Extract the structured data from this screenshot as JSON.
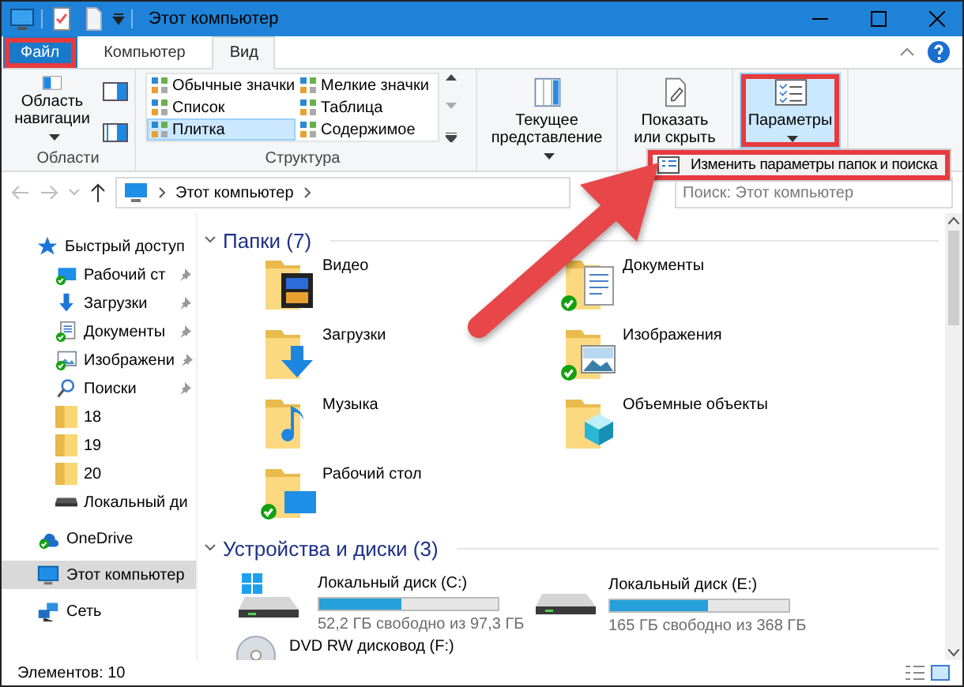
{
  "window": {
    "title": "Этот компьютер"
  },
  "ribbon": {
    "tabs": [
      {
        "label": "Файл",
        "kind": "file",
        "selected": false,
        "highlighted": true
      },
      {
        "label": "Компьютер",
        "kind": "tab",
        "selected": false,
        "highlighted": false
      },
      {
        "label": "Вид",
        "kind": "tab",
        "selected": true,
        "highlighted": false
      }
    ],
    "panes_group": {
      "label": "Области",
      "nav_button": "Область навигации"
    },
    "layout_group": {
      "label": "Структура",
      "layouts": [
        {
          "label": "Обычные значки",
          "selected": false
        },
        {
          "label": "Мелкие значки",
          "selected": false
        },
        {
          "label": "Список",
          "selected": false
        },
        {
          "label": "Таблица",
          "selected": false
        },
        {
          "label": "Плитка",
          "selected": true
        },
        {
          "label": "Содержимое",
          "selected": false
        }
      ]
    },
    "buttons": [
      {
        "label": "Текущее представление",
        "kind": "view",
        "pressed": false,
        "highlighted": false
      },
      {
        "label": "Показать или скрыть",
        "kind": "show",
        "pressed": false,
        "highlighted": false
      },
      {
        "label": "Параметры",
        "kind": "options",
        "pressed": true,
        "highlighted": true
      }
    ]
  },
  "menu": {
    "items": [
      {
        "label": "Изменить параметры папок и поиска",
        "highlighted": true
      }
    ]
  },
  "address": {
    "path": "Этот компьютер"
  },
  "search": {
    "placeholder": "Поиск: Этот компьютер"
  },
  "nav_pane": {
    "items": [
      {
        "label": "Быстрый доступ",
        "kind": "star",
        "selected": false,
        "children": [
          {
            "label": "Рабочий ст",
            "kind": "desktop",
            "pinned": true
          },
          {
            "label": "Загрузки",
            "kind": "downloads",
            "pinned": true
          },
          {
            "label": "Документы",
            "kind": "documents",
            "pinned": true
          },
          {
            "label": "Изображени",
            "kind": "pictures",
            "pinned": true
          },
          {
            "label": "Поиски",
            "kind": "search",
            "pinned": true
          },
          {
            "label": "18",
            "kind": "folder",
            "pinned": false
          },
          {
            "label": "19",
            "kind": "folder",
            "pinned": false
          },
          {
            "label": "20",
            "kind": "folder",
            "pinned": false
          },
          {
            "label": "Локальный ди",
            "kind": "drive",
            "pinned": false
          }
        ]
      },
      {
        "label": "OneDrive",
        "kind": "onedrive",
        "selected": false
      },
      {
        "label": "Этот компьютер",
        "kind": "computer",
        "selected": true
      },
      {
        "label": "Сеть",
        "kind": "network",
        "selected": false
      }
    ]
  },
  "sections": [
    {
      "title": "Папки (7)",
      "kind": "folders",
      "expanded": true,
      "items": [
        {
          "label": "Видео",
          "kind": "video",
          "synced": false
        },
        {
          "label": "Документы",
          "kind": "documents",
          "synced": true
        },
        {
          "label": "Загрузки",
          "kind": "downloads",
          "synced": false
        },
        {
          "label": "Изображения",
          "kind": "pictures",
          "synced": true
        },
        {
          "label": "Музыка",
          "kind": "music",
          "synced": false
        },
        {
          "label": "Объемные объекты",
          "kind": "objects",
          "synced": false
        },
        {
          "label": "Рабочий стол",
          "kind": "desktop",
          "synced": true
        }
      ]
    },
    {
      "title": "Устройства и диски (3)",
      "kind": "drives",
      "expanded": true,
      "items": [
        {
          "label": "Локальный диск (C:)",
          "kind": "system",
          "level": 0.46,
          "free": "52,2 ГБ свободно из 97,3 ГБ"
        },
        {
          "label": "Локальный диск (E:)",
          "kind": "disk",
          "level": 0.55,
          "free": "165 ГБ свободно из 368 ГБ"
        },
        {
          "label": "DVD RW дисковод (F:)",
          "kind": "dvd"
        }
      ]
    }
  ],
  "status_bar": {
    "count": "Элементов: 10"
  }
}
